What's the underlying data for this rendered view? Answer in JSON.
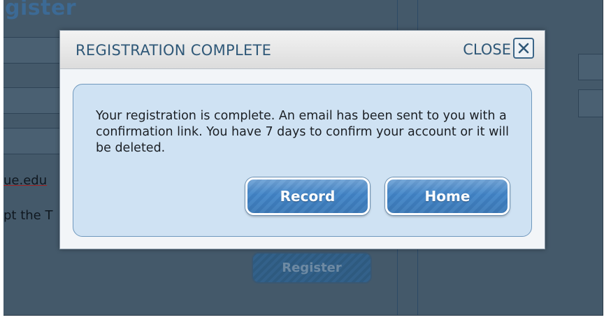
{
  "background": {
    "page_title": "gister",
    "email_fragment": "ue.edu",
    "terms_fragment": "pt the T",
    "register_label": "Register"
  },
  "modal": {
    "title": "REGISTRATION COMPLETE",
    "close_label": "CLOSE",
    "message": "Your registration is complete. An email has been sent to you with a confirmation link. You have 7 days to confirm your account or it will be deleted.",
    "buttons": {
      "record_label": "Record",
      "home_label": "Home"
    }
  },
  "colors": {
    "overlay": "#44596a",
    "header_text": "#2f5878",
    "inner_panel": "#cfe2f3",
    "button": "#3f7fc0"
  },
  "icons": {
    "close": "close-icon"
  }
}
